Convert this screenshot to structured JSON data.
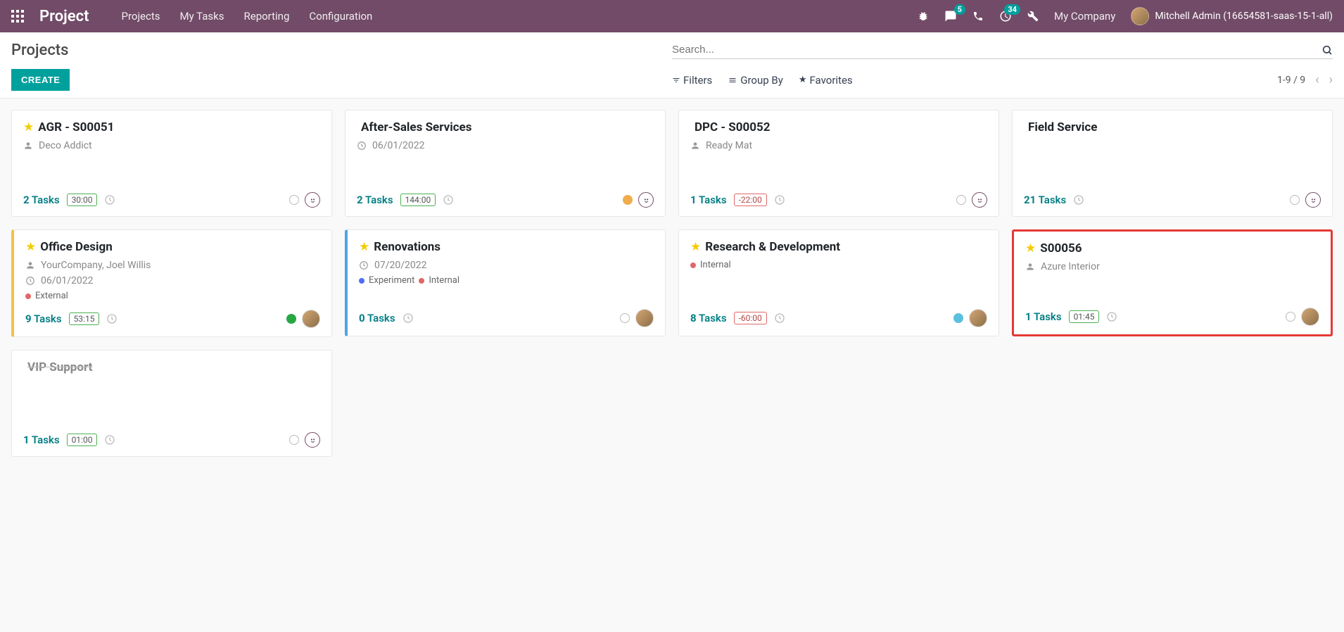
{
  "navbar": {
    "brand": "Project",
    "menu": [
      "Projects",
      "My Tasks",
      "Reporting",
      "Configuration"
    ],
    "messages_badge": "5",
    "activities_badge": "34",
    "company": "My Company",
    "user": "Mitchell Admin (16654581-saas-15-1-all)"
  },
  "control_panel": {
    "title": "Projects",
    "search_placeholder": "Search...",
    "create_label": "CREATE",
    "filters_label": "Filters",
    "groupby_label": "Group By",
    "favorites_label": "Favorites",
    "pager": "1-9 / 9"
  },
  "projects": [
    {
      "starred": true,
      "title": "AGR - S00051",
      "partner": "Deco Addict",
      "date": null,
      "tags": [],
      "task_count": "2",
      "task_label": "Tasks",
      "time": "30:00",
      "time_neg": false,
      "show_clock": true,
      "status": "empty",
      "show_smiley": true,
      "stripe": null,
      "avatar": false,
      "highlighted": false,
      "title_muted": false
    },
    {
      "starred": false,
      "title": "After-Sales Services",
      "partner": null,
      "date": "06/01/2022",
      "tags": [],
      "task_count": "2",
      "task_label": "Tasks",
      "time": "144:00",
      "time_neg": false,
      "show_clock": true,
      "status": "orange",
      "show_smiley": true,
      "stripe": null,
      "avatar": false,
      "highlighted": false,
      "title_muted": false
    },
    {
      "starred": false,
      "title": "DPC - S00052",
      "partner": "Ready Mat",
      "date": null,
      "tags": [],
      "task_count": "1",
      "task_label": "Tasks",
      "time": "-22:00",
      "time_neg": true,
      "show_clock": true,
      "status": "empty",
      "show_smiley": true,
      "stripe": null,
      "avatar": false,
      "highlighted": false,
      "title_muted": false
    },
    {
      "starred": false,
      "title": "Field Service",
      "partner": null,
      "date": null,
      "tags": [],
      "task_count": "21",
      "task_label": "Tasks",
      "time": null,
      "time_neg": false,
      "show_clock": true,
      "status": "empty",
      "show_smiley": true,
      "stripe": null,
      "avatar": false,
      "highlighted": false,
      "title_muted": false
    },
    {
      "starred": true,
      "title": "Office Design",
      "partner": "YourCompany, Joel Willis",
      "date": "06/01/2022",
      "tags": [
        {
          "color": "red",
          "label": "External"
        }
      ],
      "task_count": "9",
      "task_label": "Tasks",
      "time": "53:15",
      "time_neg": false,
      "show_clock": true,
      "status": "green",
      "show_smiley": false,
      "stripe": "yellow",
      "avatar": true,
      "highlighted": false,
      "title_muted": false
    },
    {
      "starred": true,
      "title": "Renovations",
      "partner": null,
      "date": "07/20/2022",
      "tags": [
        {
          "color": "blue",
          "label": "Experiment"
        },
        {
          "color": "red",
          "label": "Internal"
        }
      ],
      "task_count": "0",
      "task_label": "Tasks",
      "time": null,
      "time_neg": false,
      "show_clock": true,
      "status": "empty",
      "show_smiley": false,
      "stripe": "blue",
      "avatar": true,
      "highlighted": false,
      "title_muted": false
    },
    {
      "starred": true,
      "title": "Research & Development",
      "partner": null,
      "date": null,
      "tags": [
        {
          "color": "red",
          "label": "Internal"
        }
      ],
      "task_count": "8",
      "task_label": "Tasks",
      "time": "-60:00",
      "time_neg": true,
      "show_clock": true,
      "status": "blue",
      "show_smiley": false,
      "stripe": null,
      "avatar": true,
      "highlighted": false,
      "title_muted": false
    },
    {
      "starred": true,
      "title": "S00056",
      "partner": "Azure Interior",
      "date": null,
      "tags": [],
      "task_count": "1",
      "task_label": "Tasks",
      "time": "01:45",
      "time_neg": false,
      "show_clock": true,
      "status": "empty",
      "show_smiley": false,
      "stripe": null,
      "avatar": true,
      "highlighted": true,
      "title_muted": false
    },
    {
      "starred": false,
      "title": "VIP Support",
      "partner": null,
      "date": null,
      "tags": [],
      "task_count": "1",
      "task_label": "Tasks",
      "time": "01:00",
      "time_neg": false,
      "show_clock": true,
      "status": "empty",
      "show_smiley": true,
      "stripe": null,
      "avatar": false,
      "highlighted": false,
      "title_muted": true
    }
  ]
}
